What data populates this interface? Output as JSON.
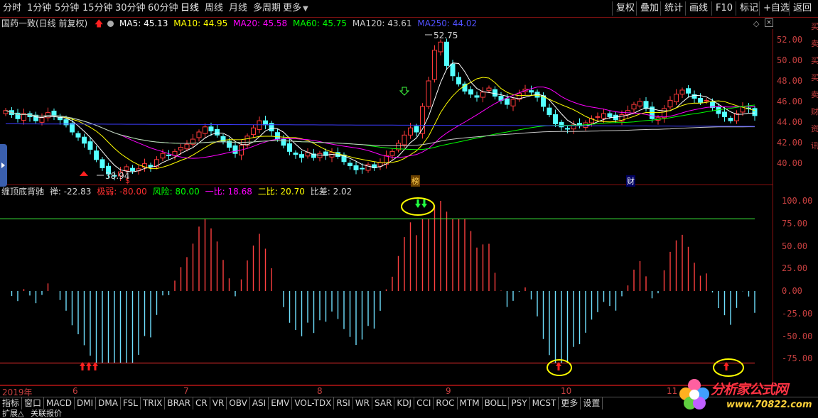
{
  "toolbar": {
    "periods": [
      "分时",
      "1分钟",
      "5分钟",
      "15分钟",
      "30分钟",
      "60分钟",
      "日线",
      "周线",
      "月线",
      "多周期",
      "更多"
    ],
    "active_period": "日线",
    "right_buttons": [
      "复权",
      "叠加",
      "统计",
      "画线",
      "F10",
      "标记",
      "+自选",
      "返回"
    ]
  },
  "infobar": {
    "title": "国药一致(日线 前复权)",
    "ma": [
      {
        "label": "MA5: 45.13",
        "color": "#ffffff"
      },
      {
        "label": "MA10: 44.95",
        "color": "#ffff00"
      },
      {
        "label": "MA20: 45.58",
        "color": "#ff00ff"
      },
      {
        "label": "MA60: 45.75",
        "color": "#00ff00"
      },
      {
        "label": "MA120: 43.61",
        "color": "#c8c8c8"
      },
      {
        "label": "MA250: 44.02",
        "color": "#3c3cff"
      }
    ]
  },
  "price_axis": [
    "52.00",
    "50.00",
    "48.00",
    "46.00",
    "44.00",
    "42.00",
    "40.00"
  ],
  "price_marks": {
    "high": "52.75",
    "low": "38.94",
    "bang": "榜",
    "cai": "财"
  },
  "indicator": {
    "name": "缠顶底背驰",
    "items": [
      {
        "label": "禅: -22.83",
        "color": "#d8d8d8"
      },
      {
        "label": "极弱: -80.00",
        "color": "#ff3030"
      },
      {
        "label": "风险: 80.00",
        "color": "#00ff00"
      },
      {
        "label": "一比: 18.68",
        "color": "#ff00ff"
      },
      {
        "label": "二比: 20.70",
        "color": "#ffff00"
      },
      {
        "label": "比差: 2.02",
        "color": "#d8d8d8"
      }
    ],
    "axis": [
      "100.00",
      "75.00",
      "50.00",
      "25.00",
      "0.00",
      "-25.00",
      "-50.00",
      "-75.00"
    ]
  },
  "dates": {
    "year": "2019年",
    "months": [
      "6",
      "7",
      "8",
      "9",
      "10",
      "11"
    ]
  },
  "bottom_tabs": [
    "指标",
    "窗口",
    "MACD",
    "DMI",
    "DMA",
    "FSL",
    "TRIX",
    "BRAR",
    "CR",
    "VR",
    "OBV",
    "ASI",
    "EMV",
    "VOL-TDX",
    "RSI",
    "WR",
    "SAR",
    "KDJ",
    "CCI",
    "ROC",
    "MTM",
    "BOLL",
    "PSY",
    "MCST",
    "更多",
    "设置"
  ],
  "status": {
    "left": "扩展△",
    "right": "关联报价"
  },
  "side_text": "买卖买买卖财资讯",
  "logo": {
    "text": "分析家公式网",
    "url": "www.70822.com"
  },
  "chart_data": {
    "type": "candlestick",
    "ylim": [
      38.5,
      53.5
    ],
    "closes": [
      45.6,
      45.2,
      44.8,
      45.3,
      45.0,
      44.6,
      44.9,
      45.4,
      45.1,
      44.7,
      44.2,
      43.5,
      43.0,
      42.4,
      41.8,
      40.8,
      40.0,
      39.4,
      39.2,
      39.6,
      40.1,
      39.7,
      39.9,
      40.4,
      40.1,
      40.8,
      41.4,
      41.2,
      41.6,
      42.0,
      42.3,
      42.8,
      43.5,
      44.0,
      43.6,
      43.2,
      42.6,
      42.0,
      41.4,
      42.2,
      43.1,
      43.9,
      44.6,
      44.2,
      43.6,
      42.8,
      42.2,
      41.6,
      41.3,
      41.0,
      41.5,
      41.0,
      41.4,
      41.2,
      41.5,
      41.1,
      40.6,
      40.2,
      39.8,
      39.9,
      40.3,
      40.0,
      40.5,
      41.2,
      41.6,
      42.4,
      43.2,
      43.9,
      43.5,
      46.0,
      48.5,
      51.5,
      52.3,
      50.0,
      49.0,
      48.2,
      47.5,
      47.2,
      46.9,
      47.4,
      47.8,
      47.0,
      46.6,
      46.2,
      46.7,
      47.3,
      47.7,
      47.4,
      46.9,
      46.0,
      45.2,
      44.3,
      44.0,
      43.8,
      44.2,
      44.1,
      44.4,
      44.8,
      45.0,
      45.3,
      45.0,
      44.7,
      45.2,
      45.6,
      46.2,
      46.5,
      45.8,
      44.8,
      44.9,
      45.8,
      46.6,
      47.2,
      47.6,
      47.3,
      46.8,
      46.4,
      46.6,
      45.9,
      45.3,
      45.0,
      44.6,
      45.3,
      46.0,
      45.8,
      45.1
    ]
  }
}
